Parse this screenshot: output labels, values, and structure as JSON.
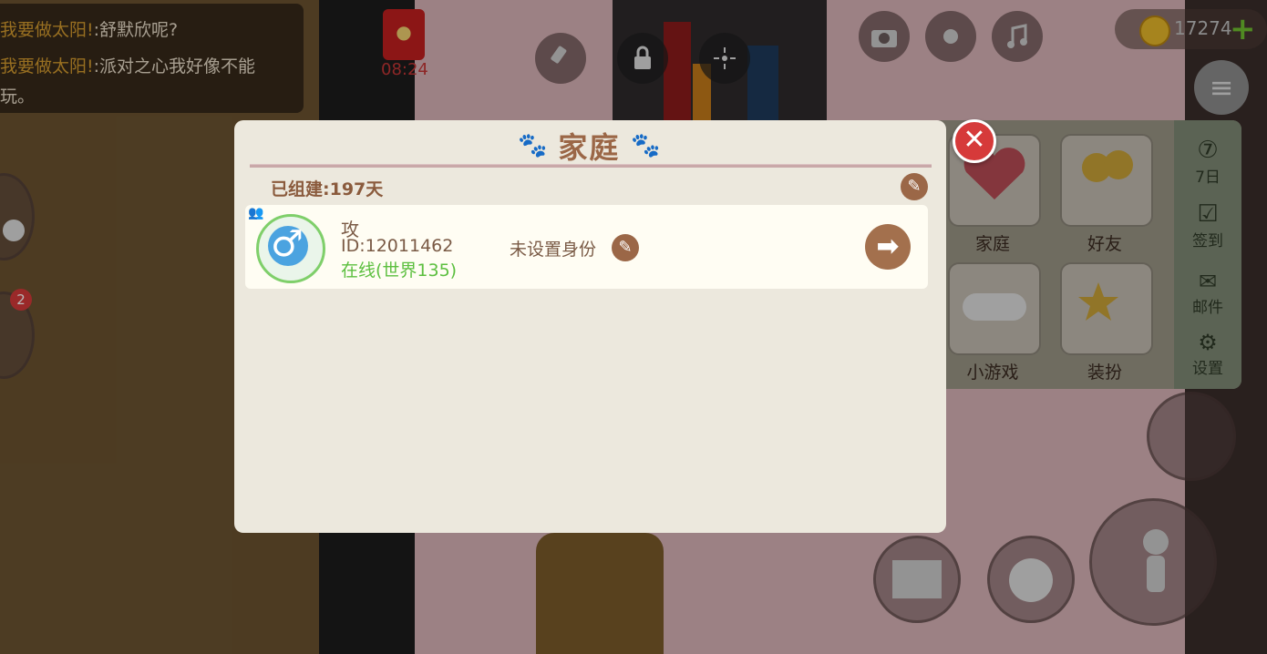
{
  "chat": {
    "lines": [
      {
        "nick": "我要做太阳!",
        "sep": ":",
        "msg": "舒默欣呢?"
      },
      {
        "nick": "我要做太阳!",
        "sep": ":",
        "msg": "派对之心我好像不能"
      },
      {
        "nick": "",
        "sep": "",
        "msg": "玩。"
      }
    ]
  },
  "topbar": {
    "timer": "08:24",
    "coins": "17274",
    "plus": "+",
    "menu_icon": "list-icon",
    "icons": [
      "camera-icon",
      "brightness-icon",
      "music-icon",
      "brush-icon",
      "lock-icon",
      "fireworks-icon"
    ]
  },
  "dialog": {
    "title": "家庭",
    "founded_label": "已组建:197天",
    "member": {
      "name": "攻",
      "id": "ID:12011462",
      "status": "在线(世界135)",
      "role": "未设置身份"
    }
  },
  "side_panel": {
    "tiles": [
      {
        "label": "家庭",
        "icon": "heart-icon"
      },
      {
        "label": "好友",
        "icon": "friends-icon"
      },
      {
        "label": "小游戏",
        "icon": "gamepad-icon"
      },
      {
        "label": "装扮",
        "icon": "wand-icon"
      }
    ],
    "column": [
      {
        "label": "7日",
        "icon": "seven-day-icon"
      },
      {
        "label": "签到",
        "icon": "checkin-icon"
      },
      {
        "label": "邮件",
        "icon": "mail-icon"
      },
      {
        "label": "设置",
        "icon": "settings-icon"
      }
    ]
  },
  "left_badges": {
    "badge_count": "2"
  },
  "colors": {
    "accent_brown": "#9b6747",
    "online_green": "#5cbf3f",
    "close_red": "#d63a3a",
    "coin_gold": "#e7b72a"
  }
}
